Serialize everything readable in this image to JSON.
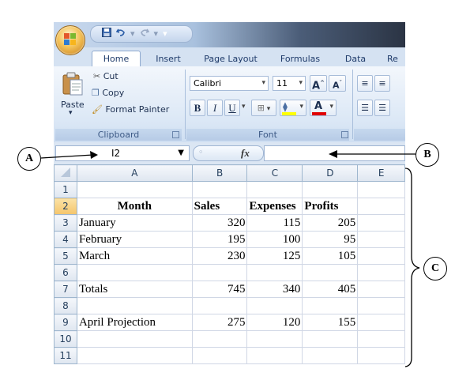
{
  "quick_access": {
    "save_icon": "save-icon",
    "undo_icon": "undo-icon",
    "redo_icon": "redo-icon"
  },
  "tabs": [
    "Home",
    "Insert",
    "Page Layout",
    "Formulas",
    "Data",
    "Re"
  ],
  "clipboard": {
    "paste_label": "Paste",
    "cut_label": "Cut",
    "copy_label": "Copy",
    "format_painter_label": "Format Painter",
    "group_label": "Clipboard"
  },
  "font": {
    "font_name": "Calibri",
    "font_size": "11",
    "bold": "B",
    "italic": "I",
    "underline": "U",
    "grow_font": "A",
    "shrink_font": "A",
    "font_color": "A",
    "group_label": "Font"
  },
  "formula_bar": {
    "name_box": "I2",
    "fx_label": "fx",
    "formula": ""
  },
  "columns": [
    "A",
    "B",
    "C",
    "D",
    "E"
  ],
  "rows": [
    {
      "n": "1",
      "a": "",
      "b": "",
      "c": "",
      "d": ""
    },
    {
      "n": "2",
      "a": "Month",
      "b": "Sales",
      "c": "Expenses",
      "d": "Profits"
    },
    {
      "n": "3",
      "a": "January",
      "b": "320",
      "c": "115",
      "d": "205"
    },
    {
      "n": "4",
      "a": "February",
      "b": "195",
      "c": "100",
      "d": "95"
    },
    {
      "n": "5",
      "a": "March",
      "b": "230",
      "c": "125",
      "d": "105"
    },
    {
      "n": "6",
      "a": "",
      "b": "",
      "c": "",
      "d": ""
    },
    {
      "n": "7",
      "a": "Totals",
      "b": "745",
      "c": "340",
      "d": "405"
    },
    {
      "n": "8",
      "a": "",
      "b": "",
      "c": "",
      "d": ""
    },
    {
      "n": "9",
      "a": "April Projection",
      "b": "275",
      "c": "120",
      "d": "155"
    },
    {
      "n": "10",
      "a": "",
      "b": "",
      "c": "",
      "d": ""
    },
    {
      "n": "11",
      "a": "",
      "b": "",
      "c": "",
      "d": ""
    }
  ],
  "annotations": {
    "a": "A",
    "b": "B",
    "c": "C"
  },
  "colors": {
    "selected_header": "#f4c56b",
    "ribbon": "#dce8f6",
    "font_color_bar": "#e00000",
    "highlight_bar": "#ffff00"
  }
}
